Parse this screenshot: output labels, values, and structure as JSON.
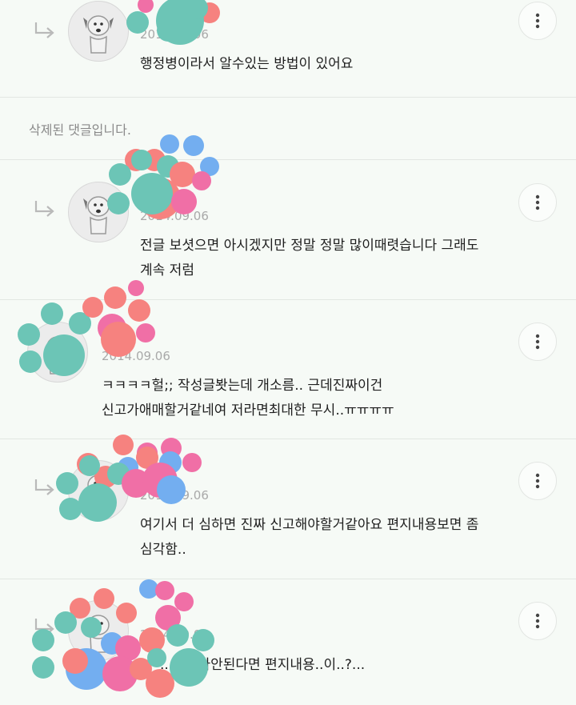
{
  "comments": [
    {
      "date": "2014.09.06",
      "text": "행정병이라서 알수있는 방법이 있어요"
    },
    {
      "deleted_text": "삭제된 댓글입니다."
    },
    {
      "date": "2014.09.06",
      "text": "전글 보셧으면 아시겠지만 정말 정말 많이때렷습니다 그래도\n계속 저럼"
    },
    {
      "date": "2014.09.06",
      "text": "ㅋㅋㅋㅋ헐;; 작성글봣는데 개소름.. 근데진짜이건\n신고가애매할거같네여 저라면최대한 무시..ㅠㅠㅠㅠ"
    },
    {
      "date": "2014.09.06",
      "text": "여기서 더 심하면 진짜 신고해야할거같아요 편지내용보면 좀\n심각함.."
    },
    {
      "date": "2014.09.06",
      "text": "...실례가안된다면 편지내용..이..?..."
    }
  ],
  "icons": {
    "reply": "reply-arrow-icon",
    "more": "more-vertical-icon",
    "avatar": "dog-avatar-icon"
  },
  "colors": {
    "paw_teal": "#6cc5b6",
    "paw_pink": "#f6827f",
    "paw_blue": "#73aef0",
    "paw_magenta": "#f06fa6"
  }
}
